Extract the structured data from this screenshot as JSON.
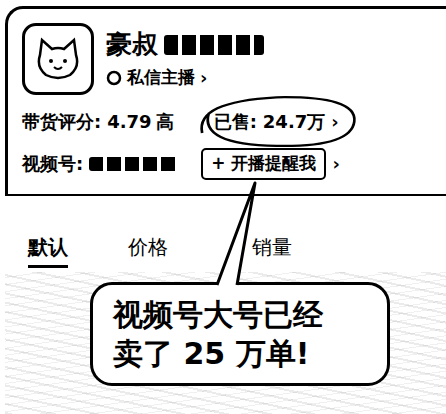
{
  "profile": {
    "name": "豪叔",
    "message_link": "私信主播",
    "message_arrow": "›",
    "rating_label": "带货评分:",
    "rating": "4.79",
    "rating_level": "高",
    "sold_label": "已售:",
    "sold": "24.7万",
    "sold_arrow": "›",
    "video_label": "视频号:",
    "remind_plus": "+",
    "remind_button": "开播提醒我",
    "remind_arrow": "›"
  },
  "tabs": [
    {
      "label": "默认",
      "selected": true
    },
    {
      "label": "价格",
      "selected": false
    },
    {
      "label": "销量",
      "selected": false
    }
  ],
  "callout": {
    "lines": [
      "视频号大号已经",
      "卖了 25 万单!"
    ]
  }
}
